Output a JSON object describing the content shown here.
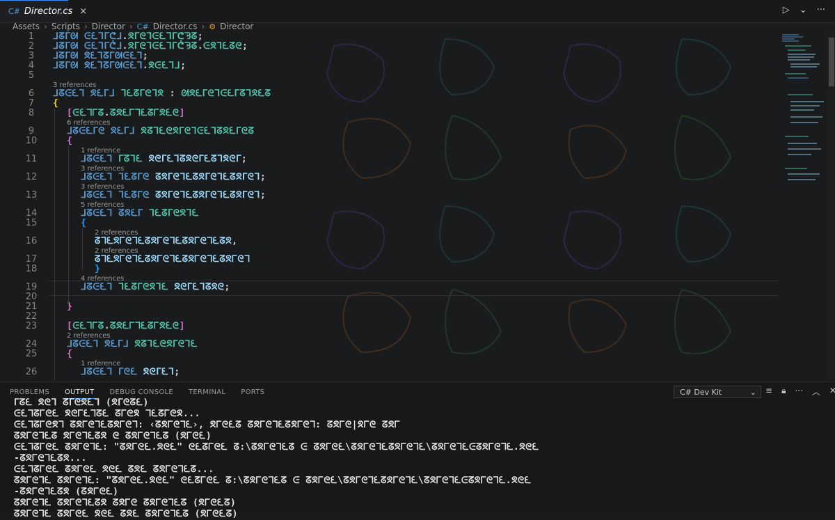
{
  "tab": {
    "icon": "csharp-file-icon",
    "name": "Director.cs",
    "close": "×"
  },
  "run_controls": {
    "run": "▷",
    "dropdown": "⌄",
    "more": "···"
  },
  "breadcrumbs": {
    "seg1": "Assets",
    "seg2": "Scripts",
    "seg3": "Director",
    "seg4": "Director.cs",
    "seg5": "Director"
  },
  "editor": {
    "lines": [
      {
        "num": "1",
        "code": [
          {
            "c": "kw",
            "t": "ᒧᘔᒥᘛ ᕮᘍᒣᒥᕧᒧ"
          },
          {
            "c": "punct",
            "t": "."
          },
          {
            "c": "tp",
            "t": "ᘝᒥᘓᒣᕮᘍᒣᒥᕧᘋᘔ"
          },
          {
            "c": "punct",
            "t": ";"
          }
        ]
      },
      {
        "num": "2",
        "code": [
          {
            "c": "kw",
            "t": "ᒧᘔᒥᘛ ᕮᘍᒣᒥᕧᒧ"
          },
          {
            "c": "punct",
            "t": "."
          },
          {
            "c": "tp",
            "t": "ᘝᒥᘓᒣᕮᘍᒣᒥᕧᘋᘔ"
          },
          {
            "c": "punct",
            "t": "."
          },
          {
            "c": "tp",
            "t": "ᕮᘝᒣᘍᘔᘓ"
          },
          {
            "c": "punct",
            "t": ";"
          }
        ]
      },
      {
        "num": "3",
        "code": [
          {
            "c": "kw",
            "t": "ᒧᘔᒥᘛ ᘝᘍᒣᘔᒥᘛᕮᘍᒣ"
          },
          {
            "c": "punct",
            "t": ";"
          }
        ]
      },
      {
        "num": "4",
        "code": [
          {
            "c": "kw",
            "t": "ᒧᘔᒥᘛ ᘝᘍᒣᘔᒥᘛᕮᘍᒣ"
          },
          {
            "c": "punct",
            "t": "."
          },
          {
            "c": "tp",
            "t": "ᘝᕮᘍᒣᒧ"
          },
          {
            "c": "punct",
            "t": ";"
          }
        ]
      },
      {
        "num": "5",
        "code": []
      },
      {
        "num": "6",
        "lens": "3 references",
        "code": [
          {
            "c": "kw",
            "t": "ᒧᘔᕮᘍᒣ ᘝᘍᒥᒧ "
          },
          {
            "c": "tp",
            "t": "ᒣᘍᘔᒥᘓᒣᘝ"
          },
          {
            "c": "punct",
            "t": " : "
          },
          {
            "c": "tp",
            "t": "ᘛᘝᘍᒥᘓᒣᕮᘍᒥᘔᒣᘝᘍᘔ"
          }
        ]
      },
      {
        "num": "7",
        "code": [
          {
            "c": "br",
            "t": "{"
          }
        ]
      },
      {
        "num": "8",
        "code": [
          {
            "c": "br2",
            "t": "["
          },
          {
            "c": "tp",
            "t": "ᕮᘍᒣᒥᘔ"
          },
          {
            "c": "punct",
            "t": "."
          },
          {
            "c": "tp",
            "t": "ᘔᘝᘍᒥᒣᘍᘔᒥᘝᘍᘓ"
          },
          {
            "c": "br2",
            "t": "]"
          }
        ]
      },
      {
        "num": "9",
        "lens": "6 references",
        "code": [
          {
            "c": "kw",
            "t": "ᒧᘔᕮᘍᒥᘓ ᘝᘍᒥᒧ "
          },
          {
            "c": "tp",
            "t": "ᘝᘔᒣᘍᘓᘝᒥᘓᒣᕮᘍᒣᘔᘝᘍᒥᘓᘔ"
          }
        ]
      },
      {
        "num": "10",
        "code": [
          {
            "c": "br2",
            "t": "{"
          }
        ]
      },
      {
        "num": "11",
        "lens": "1 reference",
        "code": [
          {
            "c": "kw",
            "t": "ᒧᘔᕮᘍᒣ "
          },
          {
            "c": "tp",
            "t": "ᒥᘔᒣᘍ "
          },
          {
            "c": "fld",
            "t": "ᘝᘓᒥᘍᒣᘔᘝᘓᒥᘍᘔᒣᘝᘓᒥ"
          },
          {
            "c": "punct",
            "t": ";"
          }
        ]
      },
      {
        "num": "12",
        "lens": "3 references",
        "code": [
          {
            "c": "kw",
            "t": "ᒧᘔᕮᘍᒣ ᒣᘍᘔᒥᘓ "
          },
          {
            "c": "fld",
            "t": "ᘔᘝᒥᘓᒣᘍᘔᘝᒥᘓᒣᘍᘔᘝᒥᘓᒣ"
          },
          {
            "c": "punct",
            "t": ";"
          }
        ]
      },
      {
        "num": "13",
        "lens": "3 references",
        "code": [
          {
            "c": "kw",
            "t": "ᒧᘔᕮᘍᒣ ᒣᘍᘔᒥᘓ "
          },
          {
            "c": "fld",
            "t": "ᘔᘝᒥᘓᒣᘍᘔᘝᒥᘓᒣᘍᘔᘝᒥᘓᒣ"
          },
          {
            "c": "punct",
            "t": ";"
          }
        ]
      },
      {
        "num": "14",
        "lens": "5 references",
        "code": [
          {
            "c": "kw",
            "t": "ᒧᘔᕮᘍᒣ ᘔᘝᘍᒥ "
          },
          {
            "c": "tp",
            "t": "ᒣᘍᘔᒥᘓᘝᒣᘍ"
          }
        ]
      },
      {
        "num": "15",
        "code": [
          {
            "c": "br3",
            "t": "{"
          }
        ]
      },
      {
        "num": "16",
        "lens": "2 references",
        "code": [
          {
            "c": "fld",
            "t": "ᘔᒣᘍᘝᒥᘓᒣᘍᘔᘝᒥᘓᒣᘍᘔᘝᒥᘓᒣᘍᘔᘝ"
          },
          {
            "c": "punct",
            "t": ","
          }
        ]
      },
      {
        "num": "17",
        "lens": "2 references",
        "code": [
          {
            "c": "fld",
            "t": "ᘔᒣᘍᘝᒥᘓᒣᘍᘔᘝᒥᘓᒣᘍᘔᘝᒥᘓᒣᘍᘔᘝᒥᘓᒣ"
          }
        ]
      },
      {
        "num": "18",
        "code": [
          {
            "c": "br3",
            "t": "}"
          }
        ]
      },
      {
        "num": "19",
        "lens": "4 references",
        "code": [
          {
            "c": "kw",
            "t": "ᒧᘔᕮᘍᒣ "
          },
          {
            "c": "tp",
            "t": "ᒣᘍᘔᒥᘓᘝᒣᘍ "
          },
          {
            "c": "fld",
            "t": "ᘝᘓᒥᘍᒣᘔᘝᘓ"
          },
          {
            "c": "punct",
            "t": ";"
          }
        ]
      },
      {
        "num": "20",
        "code": []
      },
      {
        "num": "21",
        "code": [
          {
            "c": "br2",
            "t": "}"
          }
        ]
      },
      {
        "num": "22",
        "code": []
      },
      {
        "num": "23",
        "code": [
          {
            "c": "br2",
            "t": "["
          },
          {
            "c": "tp",
            "t": "ᕮᘍᒣᒥᘔ"
          },
          {
            "c": "punct",
            "t": "."
          },
          {
            "c": "tp",
            "t": "ᘔᘝᘍᒥᒣᘍᘔᒥᘝᘍᘓ"
          },
          {
            "c": "br2",
            "t": "]"
          }
        ]
      },
      {
        "num": "24",
        "lens": "2 references",
        "code": [
          {
            "c": "kw",
            "t": "ᒧᘔᕮᘍᒣ ᘝᘍᒥᒧ "
          },
          {
            "c": "tp",
            "t": "ᘝᘔᒣᘍᘓᘝᒥᘓᒣᘍ"
          }
        ]
      },
      {
        "num": "25",
        "code": [
          {
            "c": "br2",
            "t": "{"
          }
        ]
      },
      {
        "num": "26",
        "lens": "1 reference",
        "code": [
          {
            "c": "kw",
            "t": "ᒧᘔᕮᘍᒣ ᒥᘓᘍ "
          },
          {
            "c": "fld",
            "t": "ᘝᘓᒥᘍᒣ"
          },
          {
            "c": "punct",
            "t": ";"
          }
        ]
      }
    ]
  },
  "panel": {
    "tabs": [
      "PROBLEMS",
      "OUTPUT",
      "DEBUG CONSOLE",
      "TERMINAL",
      "PORTS"
    ],
    "active_tab": "OUTPUT",
    "channel": "C# Dev Kit",
    "output_lines": [
      "ᒥᘔᘍ ᘝᘓᒣ ᘔᒥᘓᘝᘍᒣ (ᘝᒥᘓᘔᘍ)",
      "ᕮᘍᒣᘔᒥᘓᘍ ᘝᘓᒥᘍᒣᘔᘍ ᘔᒥᘓᘝ ᒣᘍᘔᒥᘓᘝ...",
      "ᕮᘍᒣᘔᒥᘓᘝᒣ ᘔᘝᒥᘓᒣᘍᘔᘝᒥᘓᒣ: ‹ᘔᘝᒥᘓᒣᘍ›, ᘝᒥᘓᘍᘔ ᘔᘝᒥᘓᒣᘍᘔᘝᒥᘓᒣ: ᘔᘝᒥᘓ|ᘝᒥᘓ ᘔᘝᒥ",
      "ᘔᘝᒥᘓᒣᘍᘔ ᘝᒥᘓᒣᘍᘔᘝ ᘓ ᘔᘝᒥᘓᒣᘍᘔ (ᘝᒥᘓᘍ)",
      "ᕮᘍᒣᘔᒥᘓᘍ ᘔᘝᒥᘓᒣᘍ: \"ᘔᘝᒥᘓᘍ.ᘝᘓᘍ\" ᘓᘍᘔᒥᘓᘍ ᘔ:\\ᘔᘝᒥᘓᒣᘍᘔ ᕮ ᘔᘝᒥᘓᘍ\\ᘔᘝᒥᘓᒣᘍᘔᘝᒥᘓᒣᘍ\\ᘔᘝᒥᘓᒣᘍᕮᘔᘝᒥᘓᒣᘍ.ᘝᘓᘍ",
      "-ᘔᘝᒥᘓᒣᘍᘔᘝ...",
      "ᕮᘍᒣᘔᒥᘓᘍ ᘔᘝᒥᘓᘍ ᘝᘓᘍ ᘔᘝᘍ ᘔᘝᒥᘓᒣᘍᘔ...",
      "ᘔᘝᒥᘓᒣᘍ ᘔᘝᒥᘓᒣᘍ: \"ᘔᘝᒥᘓᘍ.ᘝᘓᘍ\" ᘓᘍᘔᒥᘓᘍ ᘔ:\\ᘔᘝᒥᘓᒣᘍᘔ ᕮ ᘔᘝᒥᘓᘍ\\ᘔᘝᒥᘓᒣᘍᘔᘝᒥᘓᒣᘍ\\ᘔᘝᒥᘓᒣᘍᕮᘔᘝᒥᘓᒣᘍ.ᘝᘓᘍ",
      "-ᘔᘝᒥᘓᒣᘍᘔᘝ (ᘔᘝᒥᘓᘍ)",
      "ᘔᘝᒥᘓᒣᘍ ᘔᘝᒥᘓᒣᘍᘔᘝ ᘔᘝᒥᘓ ᘔᘝᒥᘓᒣᘍᘔ (ᘝᒥᘓᘍᘔ)",
      "ᘔᘝᒥᘓᒣᘍ ᘔᘝᒥᘓᘍ ᘝᘓᘍ ᘔᘝᘍ ᘔᘝᒥᘓᒣᘍᘔ (ᘝᒥᘓᘍᘔ)"
    ]
  },
  "colors": {
    "accent": "#3794ff",
    "keyword": "#569cd6",
    "type": "#4ec9b0",
    "field": "#9cdcfe",
    "bracket": "#ffd700"
  }
}
